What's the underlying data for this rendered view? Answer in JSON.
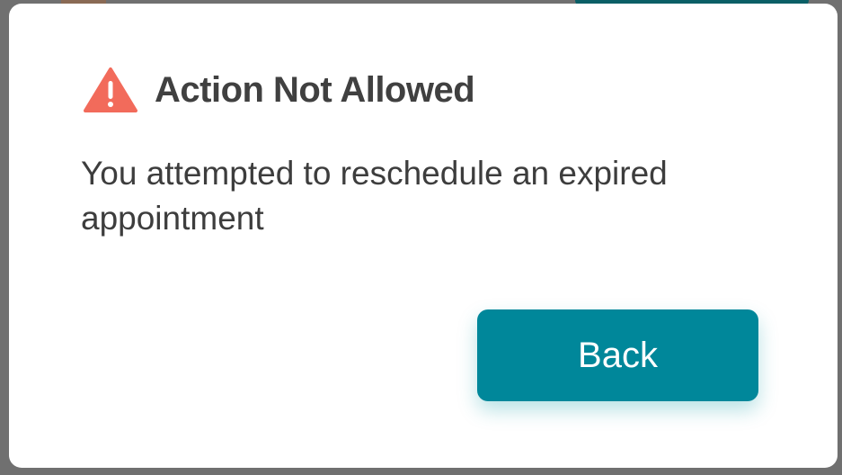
{
  "dialog": {
    "title": "Action Not Allowed",
    "message": "You attempted to reschedule an expired appointment",
    "back_label": "Back",
    "icon": "warning-triangle-icon"
  },
  "colors": {
    "warning": "#f26b5b",
    "primary": "#00879a",
    "title_text": "#404040",
    "body_text": "#3d3d3d",
    "overlay": "#707070"
  }
}
